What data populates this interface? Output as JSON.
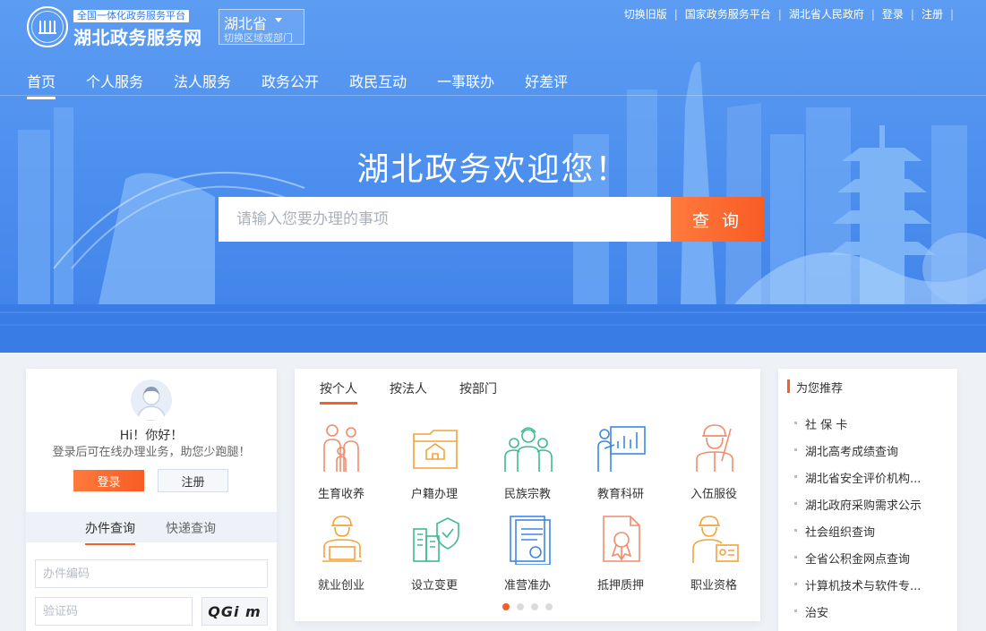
{
  "header": {
    "site_tag": "全国一体化政务服务平台",
    "site_name": "湖北政务服务网",
    "region": {
      "name": "湖北省",
      "hint": "切换区域或部门"
    },
    "top_links": [
      "切换旧版",
      "国家政务服务平台",
      "湖北省人民政府",
      "登录",
      "注册"
    ],
    "nav": [
      "首页",
      "个人服务",
      "法人服务",
      "政务公开",
      "政民互动",
      "一事联办",
      "好差评"
    ],
    "active_nav": 0
  },
  "hero": {
    "welcome": "湖北政务欢迎您！",
    "search_placeholder": "请输入您要办理的事项",
    "search_button": "查 询"
  },
  "login": {
    "greeting": "Hi！你好！",
    "subtitle": "登录后可在线办理业务，助您少跑腿！",
    "login_button": "登录",
    "register_button": "注册",
    "tabs": [
      "办件查询",
      "快递查询"
    ],
    "case_placeholder": "办件编码",
    "captcha_placeholder": "验证码",
    "captcha_text": "QGi m"
  },
  "services": {
    "tabs": [
      "按个人",
      "按法人",
      "按部门"
    ],
    "items": [
      {
        "label": "生育收养",
        "icon": "family-icon",
        "color": "#f28b6c"
      },
      {
        "label": "户籍办理",
        "icon": "household-register-icon",
        "color": "#f2a33a"
      },
      {
        "label": "民族宗教",
        "icon": "ethnic-people-icon",
        "color": "#3dbb8f"
      },
      {
        "label": "教育科研",
        "icon": "teacher-board-icon",
        "color": "#3f86e4"
      },
      {
        "label": "入伍服役",
        "icon": "soldier-icon",
        "color": "#f28b6c"
      },
      {
        "label": "就业创业",
        "icon": "worker-laptop-icon",
        "color": "#f2a33a"
      },
      {
        "label": "设立变更",
        "icon": "buildings-shield-icon",
        "color": "#3dbb8f"
      },
      {
        "label": "准营准办",
        "icon": "certificate-icon",
        "color": "#3f86e4"
      },
      {
        "label": "抵押质押",
        "icon": "mortgage-document-icon",
        "color": "#f28b6c"
      },
      {
        "label": "职业资格",
        "icon": "professional-card-icon",
        "color": "#f2a33a"
      }
    ],
    "pages": 4,
    "active_page": 0
  },
  "recommend": {
    "title": "为您推荐",
    "items": [
      "社 保 卡",
      "湖北高考成绩查询",
      "湖北省安全评价机构...",
      "湖北政府采购需求公示",
      "社会组织查询",
      "全省公积金网点查询",
      "计算机技术与软件专...",
      "治安"
    ]
  }
}
